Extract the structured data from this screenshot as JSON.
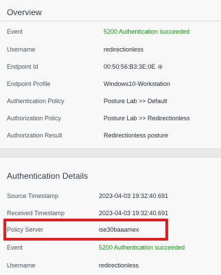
{
  "overview": {
    "title": "Overview",
    "rows": [
      {
        "label": "Event",
        "value": "5200 Authentication succeeded"
      },
      {
        "label": "Username",
        "value": "redirectionless"
      },
      {
        "label": "Endpoint Id",
        "value": "00:50:56:B3:3E:0E"
      },
      {
        "label": "Endpoint Profile",
        "value": "Windows10-Workstation"
      },
      {
        "label": "Authentication Policy",
        "value": "Posture Lab >> Default"
      },
      {
        "label": "Authorization Policy",
        "value": "Posture Lab >> Redirectionless"
      },
      {
        "label": "Authorization Result",
        "value": "Redirectionless posture"
      }
    ],
    "endpoint_pin_icon": "target-icon"
  },
  "auth_details": {
    "title": "Authentication Details",
    "rows": [
      {
        "label": "Source Timestamp",
        "value": "2023-04-03 19:32:40.691"
      },
      {
        "label": "Received Timestamp",
        "value": "2023-04-03 19:32:40.691"
      },
      {
        "label": "Policy Server",
        "value": "ise30baaamex"
      },
      {
        "label": "Event",
        "value": "5200 Authentication succeeded"
      },
      {
        "label": "Username",
        "value": "redirectionless"
      }
    ]
  },
  "colors": {
    "success": "#1a8a1a",
    "highlight": "#e02020",
    "background": "#f8f8f8"
  }
}
